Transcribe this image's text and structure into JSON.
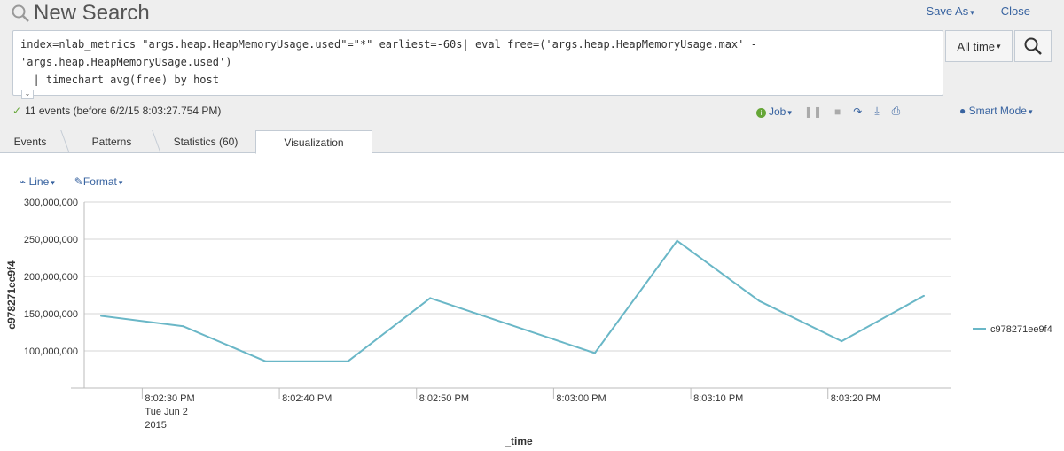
{
  "header": {
    "title": "New Search",
    "save_as": "Save As",
    "close": "Close"
  },
  "search": {
    "query_line1": "index=nlab_metrics \"args.heap.HeapMemoryUsage.used\"=\"*\" earliest=-60s| eval free=('args.heap.HeapMemoryUsage.max' -",
    "query_line2": "'args.heap.HeapMemoryUsage.used')",
    "query_line3": "  | timechart avg(free) by host",
    "time_range": "All time"
  },
  "status": {
    "events_text": "11 events (before 6/2/15 8:03:27.754 PM)",
    "job_label": "Job",
    "smart_mode": "Smart Mode"
  },
  "tabs": [
    {
      "label": "Events"
    },
    {
      "label": "Patterns"
    },
    {
      "label": "Statistics (60)"
    },
    {
      "label": "Visualization"
    }
  ],
  "viz": {
    "line_label": "Line",
    "format_label": "Format"
  },
  "colors": {
    "series": "#6ab7c7",
    "link": "#3863a0",
    "ok": "#65a637"
  },
  "chart_data": {
    "type": "line",
    "xlabel": "_time",
    "ylabel": "c978271ee9f4",
    "ylim": [
      50000000,
      300000000
    ],
    "y_ticks": [
      "300,000,000",
      "250,000,000",
      "200,000,000",
      "150,000,000",
      "100,000,000"
    ],
    "y_tick_values": [
      300000000,
      250000000,
      200000000,
      150000000,
      100000000
    ],
    "x_ticks": [
      "8:02:30 PM",
      "8:02:40 PM",
      "8:02:50 PM",
      "8:03:00 PM",
      "8:03:10 PM",
      "8:03:20 PM"
    ],
    "x_ticks_first_sub": [
      "Tue Jun 2",
      "2015"
    ],
    "x": [
      "8:02:27 PM",
      "8:02:33 PM",
      "8:02:39 PM",
      "8:02:45 PM",
      "8:02:51 PM",
      "8:02:57 PM",
      "8:03:03 PM",
      "8:03:09 PM",
      "8:03:15 PM",
      "8:03:21 PM",
      "8:03:27 PM"
    ],
    "series": [
      {
        "name": "c978271ee9f4",
        "values": [
          147000000,
          133000000,
          86000000,
          86000000,
          171000000,
          134000000,
          97000000,
          248000000,
          167000000,
          113000000,
          174000000
        ]
      }
    ],
    "legend": "right",
    "grid": true
  }
}
